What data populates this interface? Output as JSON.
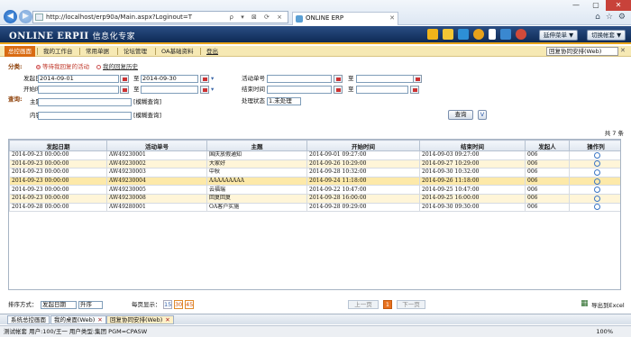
{
  "browser": {
    "url": "http://localhost/erp90a/Main.aspx?Loginout=T",
    "address_controls": "ρ ▾ ⊠ ⟳ ×",
    "tab_title": "ONLINE ERP",
    "window_controls": [
      "—",
      "▢",
      "✕"
    ],
    "toolbar_icons": [
      "home-icon",
      "star-icon",
      "gear-icon"
    ]
  },
  "header": {
    "logo": "ONLINE ERPII",
    "logo_cn": "信息化专家",
    "extend_menu": "延伸菜单 ▼",
    "switch_account": "切换帐套 ▼",
    "icon_colors": [
      "#f0b41a",
      "#f4c634",
      "#2d8fd6",
      "#e8a21a",
      "#ffffff",
      "#3a88d0",
      "#d04a3a"
    ]
  },
  "menu": {
    "items": [
      "总控画面",
      "我的工作台",
      "常用单据",
      "论坛管理",
      "OA基础资料",
      "登出"
    ],
    "dropdown": "回复协同安排(Web)",
    "close": "✕"
  },
  "filter": {
    "category_label": "分类:",
    "tab_pending": "等待我回复的活动",
    "tab_history": "我的回复历史",
    "query_label": "查询:",
    "start_date_label": "发起日期",
    "start_date_from": "2014-09-01",
    "to": "至",
    "start_date_to": "2014-09-30",
    "begin_time_label": "开始时间",
    "activity_no_label": "活动单号",
    "end_time_label": "结束时间",
    "subject_label": "主题",
    "fuzzy": "[模糊查询]",
    "content_label": "内容",
    "status_label": "处理状态",
    "status_value": "1.未处理",
    "query_button": "查询",
    "expand_button": "V"
  },
  "grid": {
    "count_text": "共 7 条",
    "columns": [
      "发起日期",
      "活动单号",
      "主题",
      "开始时间",
      "结束时间",
      "发起人",
      "操作列"
    ],
    "rows": [
      [
        "2014-09-23 00:00:00",
        "AW49230001",
        "国庆放假通知",
        "2014-09-01 09:27:00",
        "2014-09-03 09:27:00",
        "006"
      ],
      [
        "2014-09-23 00:00:00",
        "AW49230002",
        "大家好",
        "2014-09-26 10:29:00",
        "2014-09-27 10:29:00",
        "006"
      ],
      [
        "2014-09-23 00:00:00",
        "AW49230003",
        "中秋",
        "2014-09-28 10:32:00",
        "2014-09-30 10:32:00",
        "006"
      ],
      [
        "2014-09-23 00:00:00",
        "AW49230004",
        "AAAAAAAAA",
        "2014-09-24 11:18:00",
        "2014-09-26 11:18:00",
        "006"
      ],
      [
        "2014-09-23 00:00:00",
        "AW49230005",
        "云福瑞",
        "2014-09-22 10:47:00",
        "2014-09-25 10:47:00",
        "006"
      ],
      [
        "2014-09-23 00:00:00",
        "AW49230008",
        "回复回复",
        "2014-09-28 16:00:00",
        "2014-09-25 16:00:00",
        "006"
      ],
      [
        "2014-09-28 00:00:00",
        "AW49280001",
        "OA客户实施",
        "2014-09-28 09:29:00",
        "2014-09-30 09:30:00",
        "006"
      ]
    ]
  },
  "footer": {
    "sort_label": "排序方式：",
    "sort_field": "发起日期",
    "sort_order": "升序",
    "page_size_label": "每页显示：",
    "page_sizes": [
      "15",
      "30",
      "45"
    ],
    "prev_page": "上一页",
    "current_page": "1",
    "next_page": "下一页",
    "export": "导出到Excel"
  },
  "tabs": [
    {
      "label": "系统总控画面"
    },
    {
      "label": "我的桌面(Web)",
      "close": "✕"
    },
    {
      "label": "回复协同安排(Web)",
      "close": "✕"
    }
  ],
  "status": {
    "text": "测试帐套    用户:100/王一    用户类型:集团    PGM=CPASW",
    "zoom": "100%"
  }
}
